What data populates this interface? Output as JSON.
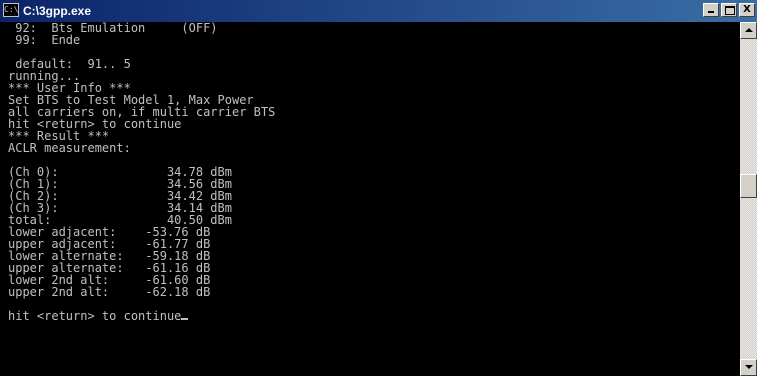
{
  "window": {
    "title": "C:\\3gpp.exe",
    "icon_label": "C:\\",
    "buttons": {
      "minimize": "_",
      "maximize": "□",
      "close": "X"
    }
  },
  "console": {
    "lines": [
      " 92:  Bts Emulation     (OFF)",
      " 99:  Ende",
      "",
      " default:  91.. 5",
      "running...",
      "*** User Info ***",
      "Set BTS to Test Model 1, Max Power",
      "all carriers on, if multi carrier BTS",
      "hit <return> to continue",
      "*** Result ***",
      "ACLR measurement:",
      "",
      "(Ch 0):               34.78 dBm",
      "(Ch 1):               34.56 dBm",
      "(Ch 2):               34.42 dBm",
      "(Ch 3):               34.14 dBm",
      "total:                40.50 dBm",
      "lower adjacent:    -53.76 dB",
      "upper adjacent:    -61.77 dB",
      "lower alternate:   -59.18 dB",
      "upper alternate:   -61.16 dB",
      "lower 2nd alt:     -61.60 dB",
      "upper 2nd alt:     -62.18 dB",
      "",
      "hit <return> to continue"
    ]
  },
  "colors": {
    "console_background": "#000000",
    "console_text": "#c0c0c0",
    "titlebar_start": "#0a246a",
    "titlebar_end": "#3a6ea5"
  },
  "icons": [
    "console-app-icon",
    "minimize-icon",
    "maximize-icon",
    "close-icon",
    "scroll-up-arrow-icon",
    "scroll-down-arrow-icon"
  ]
}
